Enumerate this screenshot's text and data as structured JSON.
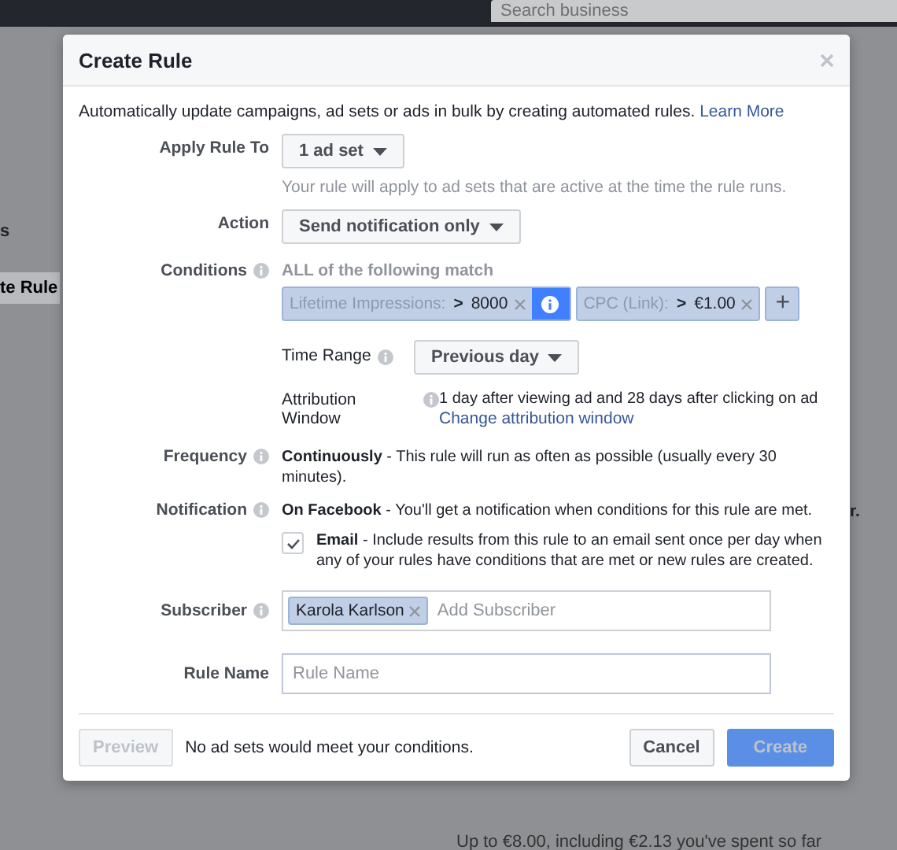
{
  "background": {
    "search": {
      "placeholder": "Search business"
    },
    "left_label": "s",
    "left_button": "te Rule",
    "right_text": "r.",
    "footer_text": "Up to €8.00, including €2.13 you've spent so far"
  },
  "dialog": {
    "title": "Create Rule",
    "intro": "Automatically update campaigns, ad sets or ads in bulk by creating automated rules.",
    "learn_more": "Learn More",
    "apply_rule_to": {
      "label": "Apply Rule To",
      "value": "1 ad set",
      "hint": "Your rule will apply to ad sets that are active at the time the rule runs."
    },
    "action": {
      "label": "Action",
      "value": "Send notification only"
    },
    "conditions": {
      "label": "Conditions",
      "heading": "ALL of the following match",
      "items": [
        {
          "metric": "Lifetime Impressions:",
          "operator": ">",
          "value": "8000",
          "selected": true
        },
        {
          "metric": "CPC (Link):",
          "operator": ">",
          "value": "€1.00",
          "selected": false
        }
      ],
      "add": "+"
    },
    "time_range": {
      "label": "Time Range",
      "value": "Previous day"
    },
    "attribution": {
      "label": "Attribution Window",
      "text": "1 day after viewing ad and 28 days after clicking on ad",
      "link": "Change attribution window"
    },
    "frequency": {
      "label": "Frequency",
      "text": "**Continuously** - This rule will run as often as possible (usually every 30 minutes)."
    },
    "notification": {
      "label": "Notification",
      "text": "**On Facebook** - You'll get a notification when conditions for this rule are met.",
      "email": {
        "checked": true,
        "text": "**Email** - Include results from this rule to an email sent once per day when any of your rules have conditions that are met or new rules are created."
      }
    },
    "subscriber": {
      "label": "Subscriber",
      "tokens": [
        "Karola Karlson"
      ],
      "placeholder": "Add Subscriber"
    },
    "rule_name": {
      "label": "Rule Name",
      "placeholder": "Rule Name"
    },
    "footer": {
      "preview": {
        "label": "Preview",
        "disabled": true
      },
      "status": "No ad sets would meet your conditions.",
      "cancel": "Cancel",
      "create": {
        "label": "Create",
        "disabled": true
      }
    }
  }
}
